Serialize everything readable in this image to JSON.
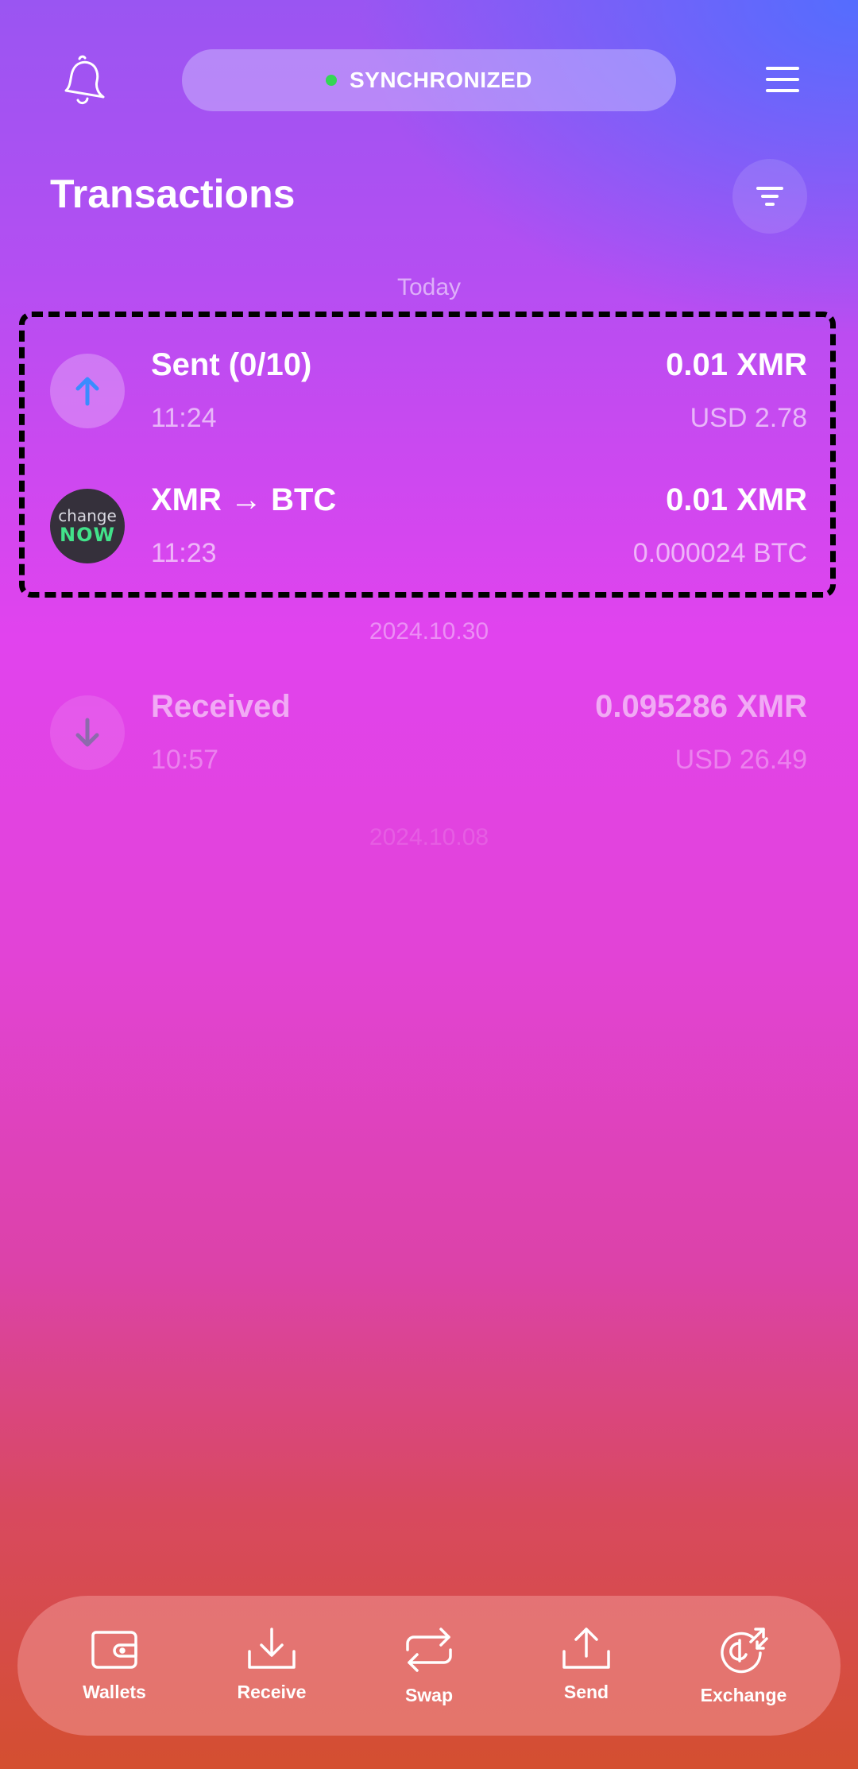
{
  "header": {
    "sync_status": "SYNCHRONIZED",
    "title": "Transactions"
  },
  "colors": {
    "sync_dot": "#33d655",
    "sent_arrow": "#3a8cff",
    "received_arrow": "#4a8a7e",
    "changenow_bg": "#35303b",
    "changenow_green": "#42e28a"
  },
  "groups": [
    {
      "date": "Today",
      "transactions": [
        {
          "icon": "arrow-up-icon",
          "title": "Sent (0/10)",
          "time": "11:24",
          "amount": "0.01 XMR",
          "fiat": "USD 2.78"
        },
        {
          "icon": "changenow-logo",
          "logo_line1": "change",
          "logo_line2": "NOW",
          "title": "XMR → BTC",
          "time": "11:23",
          "amount": "0.01 XMR",
          "fiat": "0.000024 BTC"
        }
      ]
    },
    {
      "date": "2024.10.30",
      "transactions": [
        {
          "icon": "arrow-down-icon",
          "title": "Received",
          "time": "10:57",
          "amount": "0.095286 XMR",
          "fiat": "USD 26.49"
        }
      ]
    },
    {
      "date": "2024.10.08",
      "transactions": []
    }
  ],
  "bottom_nav": [
    {
      "icon": "wallet-icon",
      "label": "Wallets"
    },
    {
      "icon": "download-icon",
      "label": "Receive"
    },
    {
      "icon": "swap-icon",
      "label": "Swap"
    },
    {
      "icon": "upload-icon",
      "label": "Send"
    },
    {
      "icon": "exchange-icon",
      "label": "Exchange"
    }
  ]
}
